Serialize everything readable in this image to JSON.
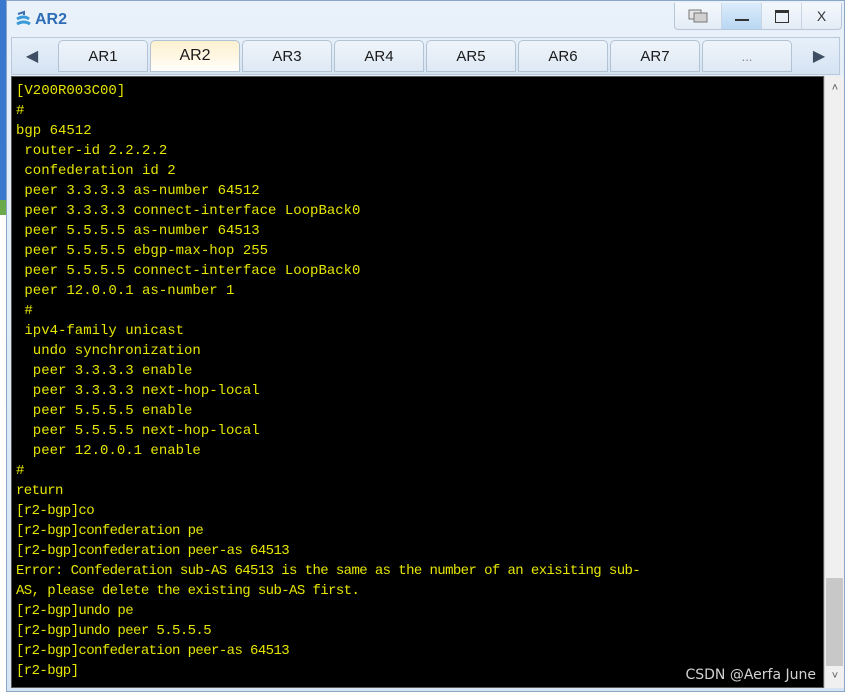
{
  "window": {
    "title": "AR2",
    "controls": {
      "restore_label": "⧉",
      "minimize_label": "_",
      "maximize_label": "▭",
      "close_label": "X"
    }
  },
  "tabbar": {
    "left_arrow": "◀",
    "right_arrow": "▶",
    "tabs": [
      {
        "label": "AR1",
        "active": false
      },
      {
        "label": "AR2",
        "active": true
      },
      {
        "label": "AR3",
        "active": false
      },
      {
        "label": "AR4",
        "active": false
      },
      {
        "label": "AR5",
        "active": false
      },
      {
        "label": "AR6",
        "active": false
      },
      {
        "label": "AR7",
        "active": false
      },
      {
        "label": "...",
        "active": false
      }
    ]
  },
  "terminal": {
    "text_color": "#e6e600",
    "background": "#000000",
    "lines": [
      "[V200R003C00]",
      "#",
      "bgp 64512",
      " router-id 2.2.2.2",
      " confederation id 2",
      " peer 3.3.3.3 as-number 64512",
      " peer 3.3.3.3 connect-interface LoopBack0",
      " peer 5.5.5.5 as-number 64513",
      " peer 5.5.5.5 ebgp-max-hop 255",
      " peer 5.5.5.5 connect-interface LoopBack0",
      " peer 12.0.0.1 as-number 1",
      " #",
      " ipv4-family unicast",
      "  undo synchronization",
      "  peer 3.3.3.3 enable",
      "  peer 3.3.3.3 next-hop-local",
      "  peer 5.5.5.5 enable",
      "  peer 5.5.5.5 next-hop-local",
      "  peer 12.0.0.1 enable",
      "#",
      "return",
      "[r2-bgp]co",
      "[r2-bgp]confederation pe",
      "[r2-bgp]confederation peer-as 64513",
      "Error: Confederation sub-AS 64513 is the same as the number of an exisiting sub-",
      "AS, please delete the existing sub-AS first.",
      "[r2-bgp]undo pe",
      "[r2-bgp]undo peer 5.5.5.5",
      "[r2-bgp]confederation peer-as 64513",
      "[r2-bgp]"
    ]
  },
  "scrollbar": {
    "up_arrow": "˄",
    "down_arrow": "˅",
    "position_fraction": 0.95
  },
  "watermark": "CSDN @Aerfa June"
}
